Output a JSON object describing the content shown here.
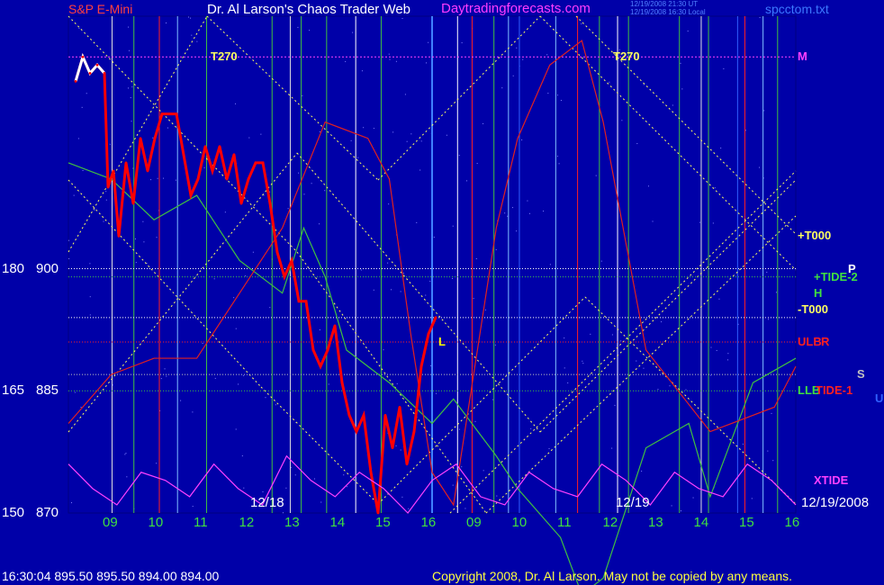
{
  "header": {
    "symbol": "S&P E-Mini",
    "title": "Dr. Al Larson's Chaos Trader Web",
    "website": "Daytradingforecasts.com",
    "timestamp_utc": "12/19/2008 21:30 UT",
    "timestamp_local": "12/19/2008 16:30 Local",
    "filename": "spcctom.txt"
  },
  "footer": {
    "quote": "16:30:04  895.50  895.50  894.00  894.00",
    "copyright": "Copyright 2008, Dr. Al Larson. May not be copied by any means."
  },
  "colors": {
    "background": "#0000A8",
    "price": "#FF0000",
    "price_highlight": "#FFFFFF",
    "tide": "#40C040",
    "xtide": "#FF40FF",
    "grid_yellow": "#FFFF60",
    "harmonic_red": "#E02020"
  },
  "chart_data": {
    "type": "line",
    "title": "S&P E-Mini",
    "ylim": [
      870,
      931
    ],
    "y_ticks": [
      {
        "angle": "150",
        "price": "870",
        "value": 870
      },
      {
        "angle": "165",
        "price": "885",
        "value": 885
      },
      {
        "angle": "180",
        "price": "900",
        "value": 900
      }
    ],
    "hour_ticks": [
      "09",
      "10",
      "11",
      "12",
      "13",
      "14",
      "15",
      "16",
      "09",
      "10",
      "11",
      "12",
      "13",
      "14",
      "15",
      "16"
    ],
    "date_labels": [
      "12/18",
      "12/19",
      "12/19/2008"
    ],
    "right_labels": [
      {
        "text": "M",
        "value": 926,
        "color": "#FF40FF"
      },
      {
        "text": "+T000",
        "value": 904,
        "color": "#FFFF60"
      },
      {
        "text": "P",
        "value": 900,
        "color": "#FFFFFF"
      },
      {
        "text": "+TIDE-2",
        "value": 899,
        "color": "#40E040"
      },
      {
        "text": "H",
        "value": 897,
        "color": "#40E040"
      },
      {
        "text": "-T000",
        "value": 895,
        "color": "#FFFF60"
      },
      {
        "text": "ULB",
        "value": 891,
        "color": "#FF2020"
      },
      {
        "text": "R",
        "value": 891,
        "color": "#FF2020"
      },
      {
        "text": "S",
        "value": 887,
        "color": "#C0C0C0"
      },
      {
        "text": "U",
        "value": 884,
        "color": "#3060FF"
      },
      {
        "text": "LLB",
        "value": 885,
        "color": "#40E040"
      },
      {
        "text": "TIDE-1",
        "value": 885,
        "color": "#FF2020"
      },
      {
        "text": "XTIDE",
        "value": 874,
        "color": "#FF40FF"
      }
    ],
    "chart_annotations": [
      {
        "text": "T270",
        "value": 926,
        "color": "#FFFF60"
      },
      {
        "text": "T270",
        "value": 926,
        "color": "#FFFF60"
      },
      {
        "text": "L",
        "value": 891,
        "color": "#FFFF00"
      }
    ],
    "series": [
      {
        "name": "S&P E-Mini price",
        "x": [
          0,
          4,
          8,
          12,
          16,
          18,
          21,
          24,
          28,
          32,
          36,
          40,
          44,
          48,
          52,
          56,
          60,
          64,
          68,
          72,
          76,
          80,
          84,
          88,
          92,
          96,
          100,
          104,
          108,
          112,
          116,
          120,
          124,
          128,
          132,
          136,
          140,
          144,
          148,
          152,
          156,
          160,
          164,
          168,
          172,
          176,
          180,
          184,
          188,
          192,
          196,
          200
        ],
        "values": [
          923,
          926,
          924,
          925,
          924,
          910,
          912,
          904,
          913,
          908,
          916,
          912,
          916,
          919,
          919,
          919,
          914,
          909,
          911,
          915,
          912,
          915,
          911,
          914,
          908,
          911,
          913,
          913,
          908,
          902,
          899,
          901,
          896,
          896,
          890,
          888,
          890,
          893,
          886,
          882,
          880,
          882,
          875,
          870,
          882,
          878,
          883,
          876,
          880,
          888,
          892,
          894
        ]
      },
      {
        "name": "Tide green",
        "x": [
          0,
          20,
          40,
          60,
          80,
          100,
          110,
          120,
          130,
          150,
          170,
          180,
          200,
          210,
          230,
          240,
          250,
          270,
          290,
          300,
          320,
          340
        ],
        "values": [
          913,
          911,
          906,
          909,
          901,
          897,
          905,
          899,
          890,
          886,
          881,
          884,
          877,
          873,
          867,
          860,
          862,
          878,
          881,
          872,
          886,
          889
        ]
      },
      {
        "name": "Tide red",
        "x": [
          0,
          20,
          40,
          60,
          80,
          100,
          120,
          140,
          150,
          160,
          170,
          180,
          200,
          210,
          225,
          240,
          250,
          270,
          300,
          330,
          340
        ],
        "values": [
          881,
          887,
          889,
          889,
          897,
          905,
          918,
          916,
          911,
          892,
          875,
          871,
          905,
          916,
          925,
          928,
          918,
          890,
          880,
          883,
          888
        ]
      }
    ],
    "xtide": {
      "name": "XTIDE",
      "values": [
        876,
        873,
        871,
        875,
        874,
        872,
        876,
        873,
        871,
        877,
        874,
        872,
        875,
        873,
        870,
        874,
        876,
        872,
        871,
        875,
        873,
        872,
        876,
        874,
        871,
        875,
        873,
        872,
        876,
        874,
        871
      ]
    }
  }
}
